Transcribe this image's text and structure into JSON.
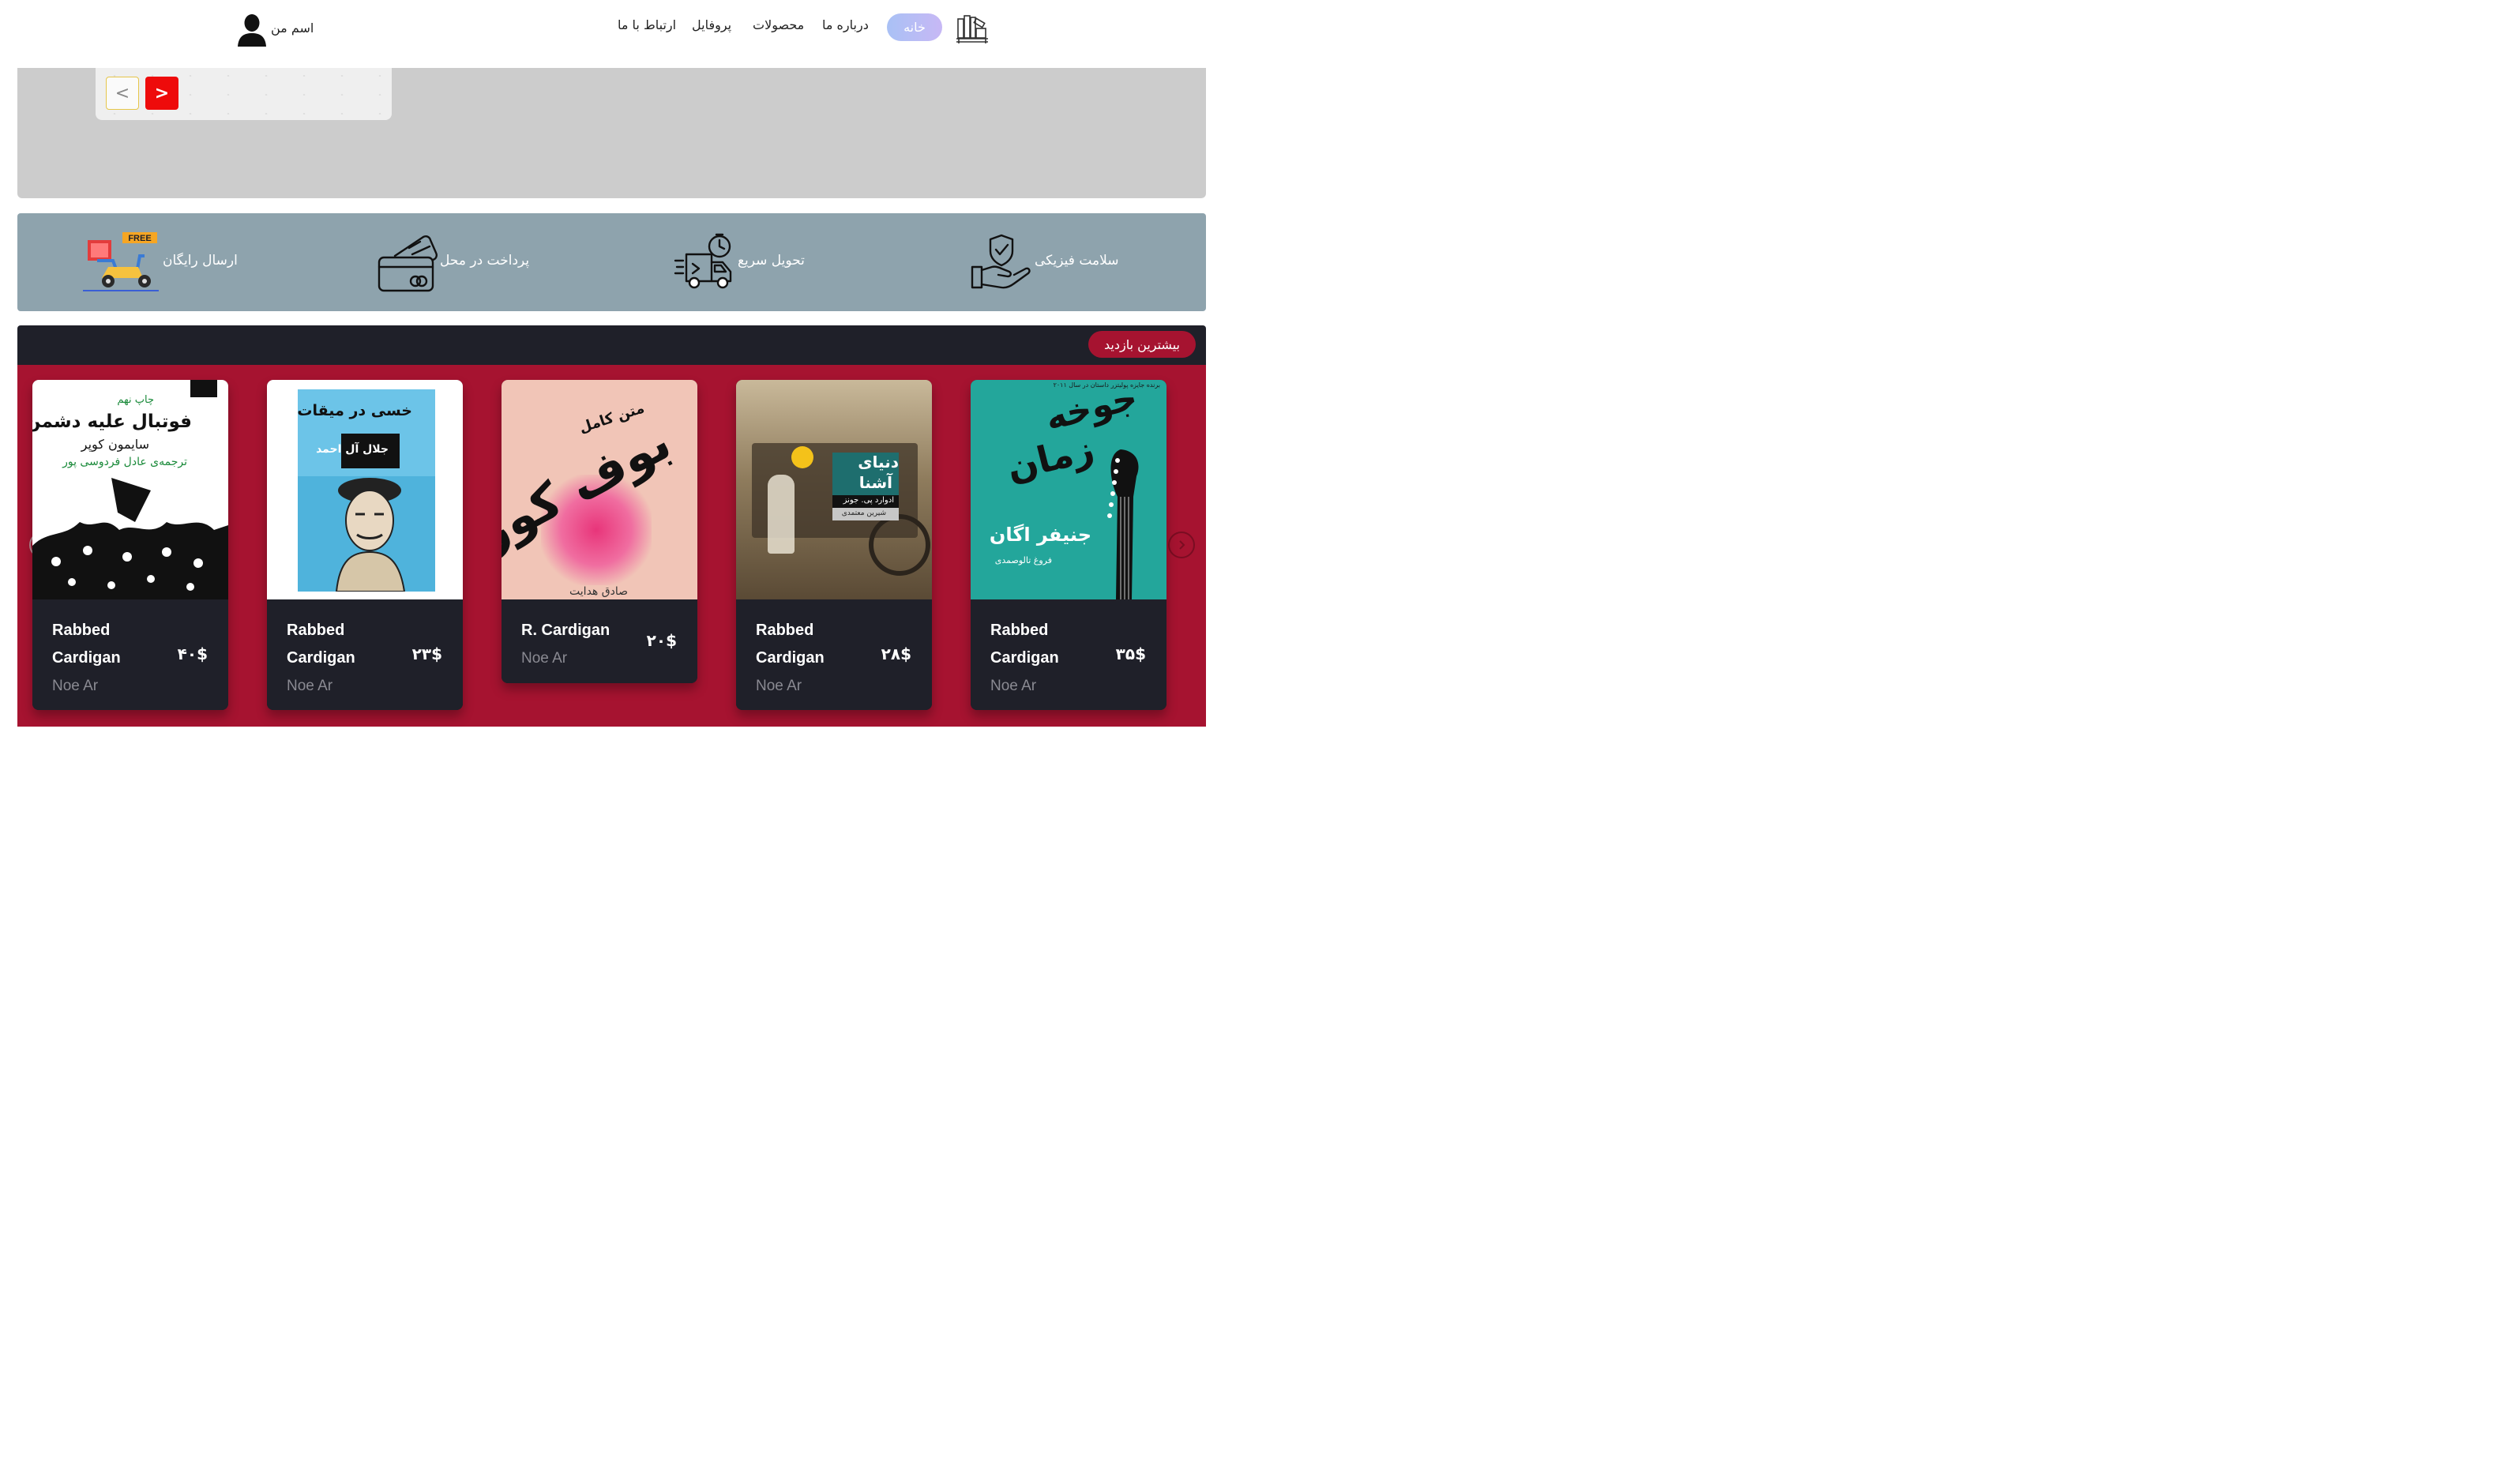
{
  "header": {
    "nav": [
      {
        "label": "خانه",
        "active": true
      },
      {
        "label": "درباره ما"
      },
      {
        "label": "محصولات"
      },
      {
        "label": "پروفایل"
      },
      {
        "label": "ارتباط با ما"
      }
    ],
    "user_name": "اسم من"
  },
  "slider": {
    "prev_label": "<",
    "next_label": ">"
  },
  "features": [
    {
      "label": "سلامت فیزیکی",
      "icon": "hand-shield-icon"
    },
    {
      "label": "تحویل سریع",
      "icon": "fast-delivery-truck-icon"
    },
    {
      "label": "پرداخت در محل",
      "icon": "credit-card-icon"
    },
    {
      "label": "ارسال رایگان",
      "icon": "free-shipping-scooter-icon",
      "badge": "FREE"
    }
  ],
  "most_visited": {
    "title": "بیشترین بازدید",
    "prev_icon": "chevron-left-icon",
    "next_icon": "chevron-right-icon",
    "books": [
      {
        "title": "Rabbed Cardigan",
        "author": "Noe Ar",
        "price": "۳۵$",
        "cover_lines": [
          "جوخه",
          "زمان",
          "جنیفر اگان",
          "فروغ تالوصمدی",
          "برنده جایزه پولیتزر داستان در سال ۲۰۱۱"
        ]
      },
      {
        "title": "Rabbed Cardigan",
        "author": "Noe Ar",
        "price": "۲۸$",
        "cover_lines": [
          "دنیای",
          "آشنا",
          "ادوارد پی. جونز",
          "شیرین معتمدی"
        ]
      },
      {
        "title": "R. Cardigan",
        "author": "Noe Ar",
        "price": "۲۰$",
        "cover_lines": [
          "بوف کور",
          "متن کامل",
          "صادق هدایت"
        ]
      },
      {
        "title": "Rabbed Cardigan",
        "author": "Noe Ar",
        "price": "۲۳$",
        "cover_lines": [
          "خسی در میقات",
          "جلال آل احمد"
        ]
      },
      {
        "title": "Rabbed Cardigan",
        "author": "Noe Ar",
        "price": "۴۰$",
        "cover_lines": [
          "چاپ نهم",
          "فوتبال علیه دشمن",
          "سایمون کوپر",
          "ترجمه‌ی عادل فردوسی پور"
        ]
      }
    ]
  },
  "colors": {
    "accent_red": "#a61330",
    "dark": "#1f2029",
    "feature_band": "#8ea3ad",
    "slider_bg": "#cccccc",
    "next_button": "#ee0b0b",
    "home_pill": "#b7bdf5"
  }
}
